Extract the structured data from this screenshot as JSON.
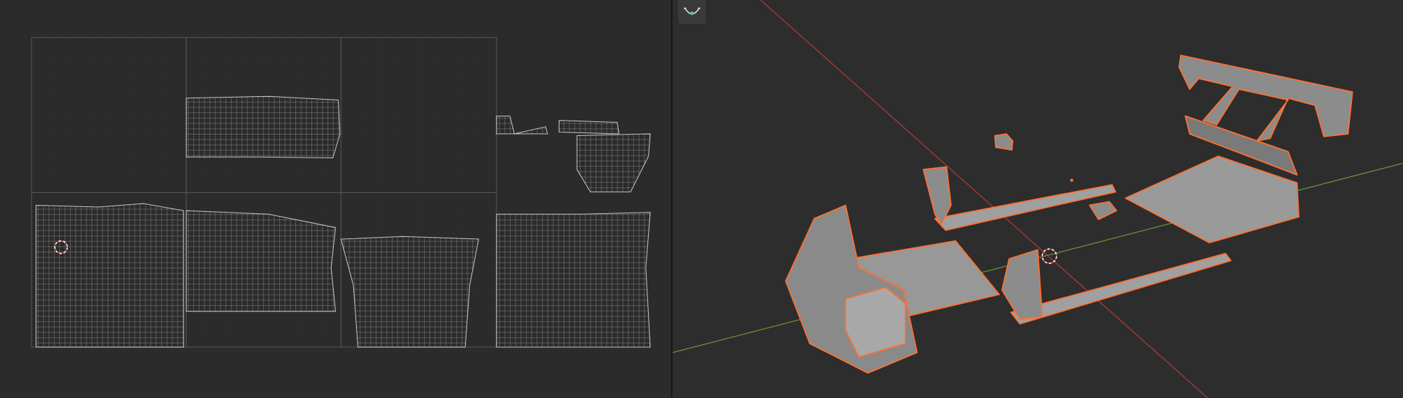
{
  "editors": [
    {
      "kind": "uv_editor"
    },
    {
      "kind": "viewport_3d"
    }
  ]
}
